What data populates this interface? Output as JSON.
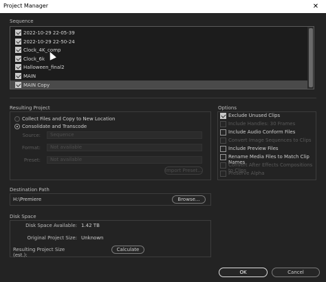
{
  "window": {
    "title": "Project Manager",
    "close_glyph": "✕"
  },
  "sequence": {
    "label": "Sequence",
    "items": [
      {
        "label": "2022-10-29 22-05-39",
        "checked": true
      },
      {
        "label": "2022-10-29 22-50-24",
        "checked": true
      },
      {
        "label": "Clock_4K_comp",
        "checked": true
      },
      {
        "label": "Clock_6k",
        "checked": true
      },
      {
        "label": "Halloween_final2",
        "checked": true
      },
      {
        "label": "MAIN",
        "checked": true
      },
      {
        "label": "MAIN Copy",
        "checked": true,
        "selected": true
      }
    ]
  },
  "resulting_project": {
    "label": "Resulting Project",
    "options": [
      {
        "label": "Collect Files and Copy to New Location",
        "selected": false,
        "enabled": false
      },
      {
        "label": "Consolidate and Transcode",
        "selected": true,
        "enabled": true
      }
    ],
    "source": {
      "label": "Source:",
      "value": "Sequence"
    },
    "format": {
      "label": "Format:",
      "value": "Not available"
    },
    "preset": {
      "label": "Preset:",
      "value": "Not available"
    },
    "import_preset_label": "Import Preset..."
  },
  "options": {
    "label": "Options",
    "items": [
      {
        "label": "Exclude Unused Clips",
        "checked": true,
        "enabled": true
      },
      {
        "label": "Include Handles: 30 Frames",
        "checked": false,
        "enabled": false
      },
      {
        "label": "Include Audio Conform Files",
        "checked": false,
        "enabled": true
      },
      {
        "label": "Convert Image Sequences to Clips",
        "checked": false,
        "enabled": false
      },
      {
        "label": "Include Preview Files",
        "checked": false,
        "enabled": true
      },
      {
        "label": "Rename Media Files to Match Clip Names",
        "checked": false,
        "enabled": true
      },
      {
        "label": "Convert After Effects Compositions to Clips",
        "checked": false,
        "enabled": false
      },
      {
        "label": "Preserve Alpha",
        "checked": false,
        "enabled": false
      }
    ]
  },
  "destination": {
    "label": "Destination Path",
    "path": "H:\\Premiere",
    "browse_label": "Browse..."
  },
  "disk_space": {
    "label": "Disk Space",
    "available_label": "Disk Space Available:",
    "available_value": "1.42 TB",
    "original_label": "Original Project Size:",
    "original_value": "Unknown",
    "resulting_label": "Resulting Project Size (est.):",
    "calculate_label": "Calculate"
  },
  "footer": {
    "ok_label": "OK",
    "cancel_label": "Cancel"
  }
}
